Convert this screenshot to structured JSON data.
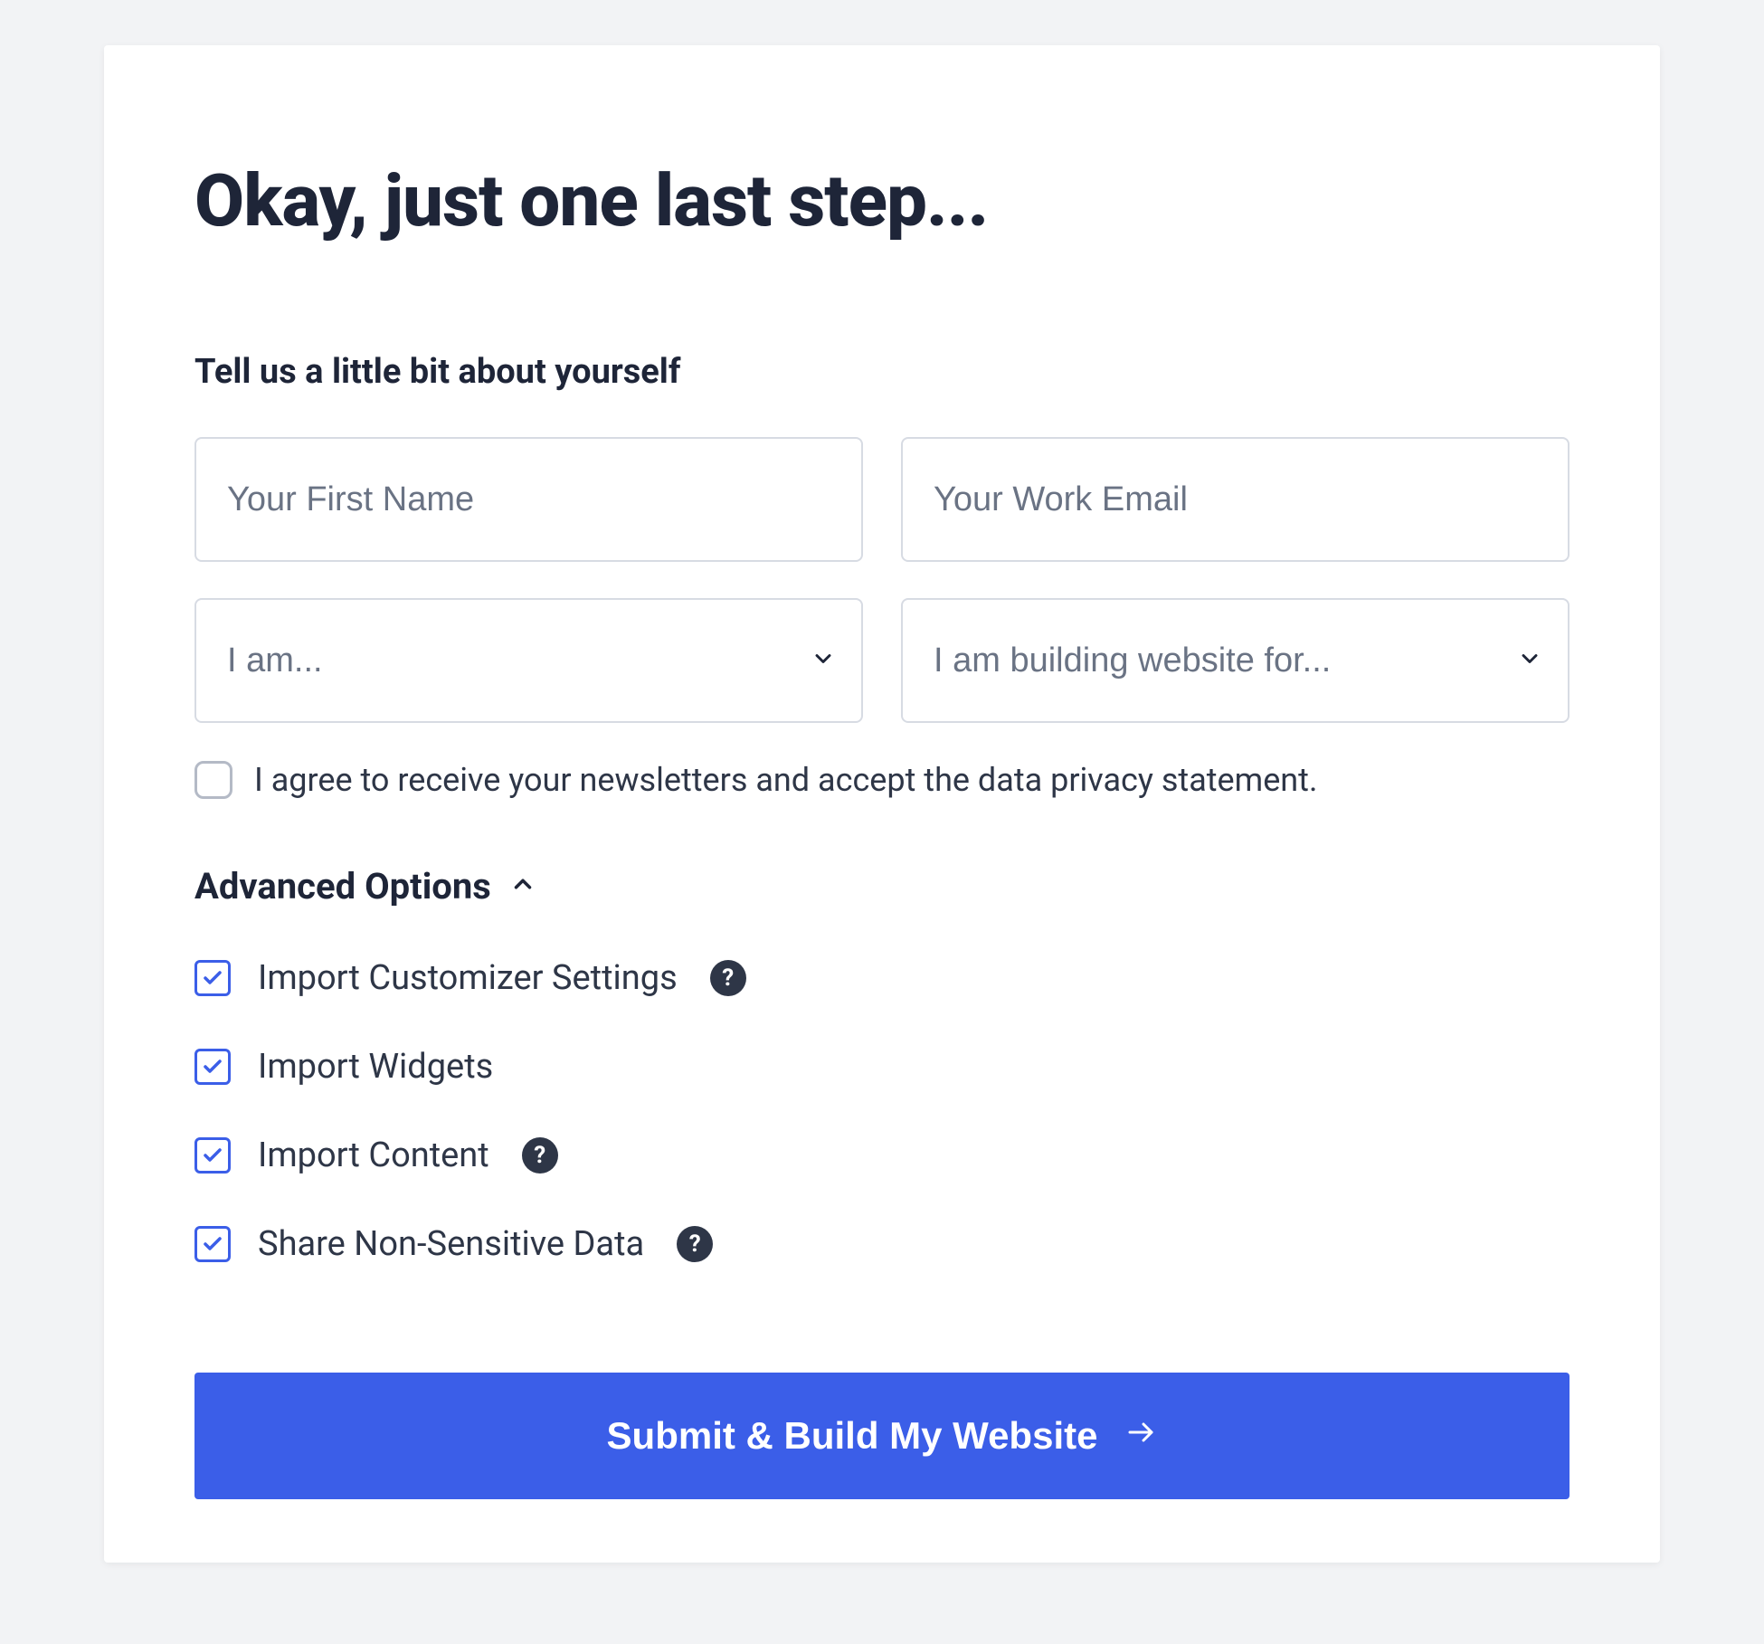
{
  "title": "Okay, just one last step...",
  "section_label": "Tell us a little bit about yourself",
  "inputs": {
    "first_name_placeholder": "Your First Name",
    "email_placeholder": "Your Work Email",
    "role_placeholder": "I am...",
    "building_for_placeholder": "I am building website for..."
  },
  "consent": {
    "label": "I agree to receive your newsletters and accept the data privacy statement.",
    "checked": false
  },
  "advanced": {
    "toggle_label": "Advanced Options",
    "expanded": true,
    "options": [
      {
        "label": "Import Customizer Settings",
        "checked": true,
        "help": true
      },
      {
        "label": "Import Widgets",
        "checked": true,
        "help": false
      },
      {
        "label": "Import Content",
        "checked": true,
        "help": true
      },
      {
        "label": "Share Non-Sensitive Data",
        "checked": true,
        "help": true
      }
    ]
  },
  "submit_label": "Submit & Build My Website",
  "help_glyph": "?",
  "colors": {
    "primary": "#3b5ee8",
    "text": "#1e2538",
    "muted": "#6a7384",
    "border": "#d7dbe3"
  }
}
